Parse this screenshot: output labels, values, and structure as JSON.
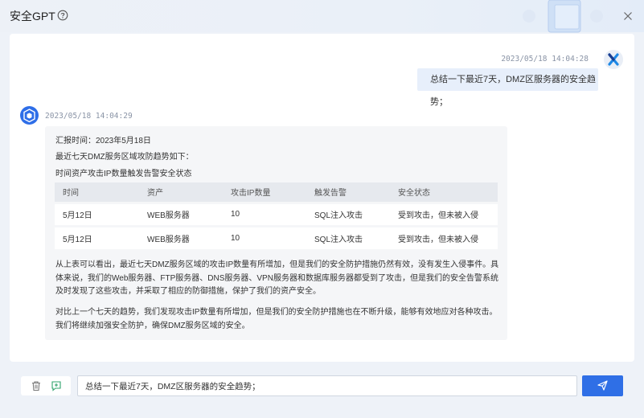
{
  "window": {
    "title": "安全GPT"
  },
  "icons": {
    "help": "help-circle-icon",
    "close": "close-icon",
    "trash": "trash-icon",
    "new_chat": "new-chat-icon",
    "send": "send-icon"
  },
  "colors": {
    "accent": "#2f6fe6",
    "user_bubble": "#e7effb",
    "bot_bubble": "#f5f6f8"
  },
  "messages": {
    "user": {
      "timestamp": "2023/05/18 14:04:28",
      "text": "总结一下最近7天，DMZ区服务器的安全趋势；"
    },
    "bot": {
      "timestamp": "2023/05/18 14:04:29",
      "line1": "汇报时间：2023年5月18日",
      "line2": "最近七天DMZ服务区域攻防趋势如下：",
      "line3": "时间资产攻击IP数量触发告警安全状态",
      "table": {
        "headers": [
          "时间",
          "资产",
          "攻击IP数量",
          "触发告警",
          "安全状态"
        ],
        "rows": [
          [
            "5月12日",
            "WEB服务器",
            "10",
            "SQL注入攻击",
            "受到攻击，但未被入侵"
          ],
          [
            "5月12日",
            "WEB服务器",
            "10",
            "SQL注入攻击",
            "受到攻击，但未被入侵"
          ]
        ]
      },
      "para1": "从上表可以看出，最近七天DMZ服务区域的攻击IP数量有所增加，但是我们的安全防护措施仍然有效，没有发生入侵事件。具体来说，我们的Web服务器、FTP服务器、DNS服务器、VPN服务器和数据库服务器都受到了攻击，但是我们的安全告警系统及时发现了这些攻击，并采取了相应的防御措施，保护了我们的资产安全。",
      "para2": "对比上一个七天的趋势，我们发现攻击IP数量有所增加，但是我们的安全防护措施也在不断升级，能够有效地应对各种攻击。我们将继续加强安全防护，确保DMZ服务区域的安全。"
    }
  },
  "composer": {
    "value": "总结一下最近7天，DMZ区服务器的安全趋势；"
  }
}
